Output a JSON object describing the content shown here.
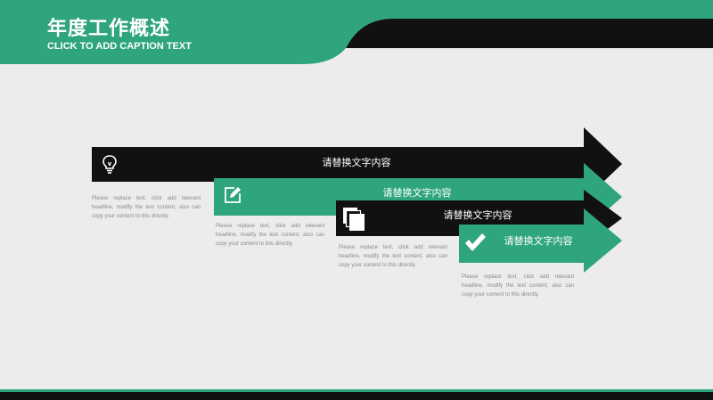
{
  "header": {
    "title": "年度工作概述",
    "subtitle": "CLICK TO ADD CAPTION TEXT"
  },
  "colors": {
    "accent": "#2fa57e",
    "dark": "#111111",
    "background": "#ececec"
  },
  "steps": [
    {
      "label": "请替换文字内容",
      "icon": "lightbulb-icon",
      "description": "Please replace text, click add relevant headline, modify the text content, also can copy your content to this directly."
    },
    {
      "label": "请替换文字内容",
      "icon": "edit-icon",
      "description": "Please replace text, click add relevant headline, modify the text content, also can copy your content to this directly."
    },
    {
      "label": "请替换文字内容",
      "icon": "documents-icon",
      "description": "Please replace text, click add relevant headline, modify the text content, also can copy your content to this directly."
    },
    {
      "label": "请替换文字内容",
      "icon": "checkmark-icon",
      "description": "Please replace text, click add relevant headline, modify the text content, also can copy your content to this directly."
    }
  ]
}
